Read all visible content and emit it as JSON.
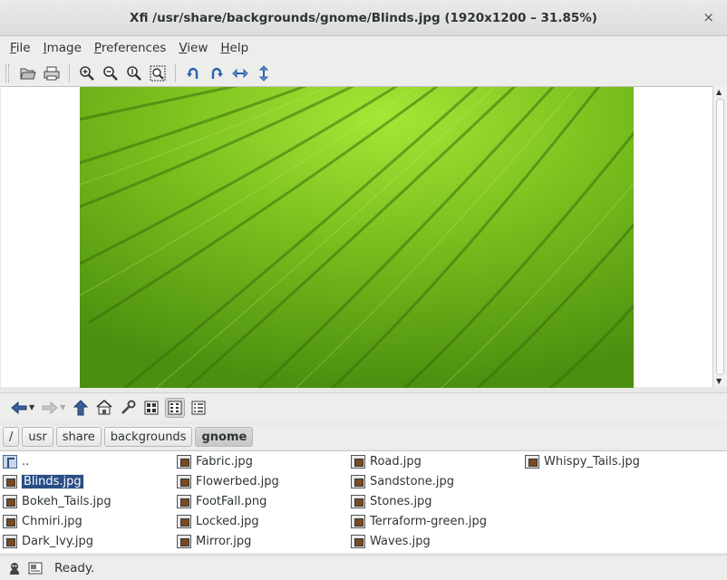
{
  "window": {
    "title": "Xfi /usr/share/backgrounds/gnome/Blinds.jpg (1920x1200 – 31.85%)",
    "close": "×"
  },
  "menu": [
    {
      "label": "File",
      "u": "F",
      "rest": "ile"
    },
    {
      "label": "Image",
      "u": "I",
      "rest": "mage"
    },
    {
      "label": "Preferences",
      "u": "P",
      "rest": "references"
    },
    {
      "label": "View",
      "u": "V",
      "rest": "iew"
    },
    {
      "label": "Help",
      "u": "H",
      "rest": "elp"
    }
  ],
  "toolbar_icons": [
    "open-folder-icon",
    "print-icon",
    "zoom-in-icon",
    "zoom-out-icon",
    "zoom-100-icon",
    "zoom-fit-icon",
    "rotate-left-icon",
    "rotate-right-icon",
    "flip-horizontal-icon",
    "flip-vertical-icon"
  ],
  "nav_icons": [
    "back-arrow-icon",
    "forward-arrow-icon",
    "up-arrow-icon",
    "home-icon",
    "wrench-icon",
    "big-icons-view-icon",
    "small-icons-view-icon",
    "details-view-icon"
  ],
  "path": {
    "crumbs": [
      "/",
      "usr",
      "share",
      "backgrounds",
      "gnome"
    ],
    "active": "gnome"
  },
  "files": {
    "col1": [
      "..",
      "Blinds.jpg",
      "Bokeh_Tails.jpg",
      "Chmiri.jpg",
      "Dark_Ivy.jpg"
    ],
    "col2": [
      "Fabric.jpg",
      "Flowerbed.jpg",
      "FootFall.png",
      "Locked.jpg",
      "Mirror.jpg"
    ],
    "col3": [
      "Road.jpg",
      "Sandstone.jpg",
      "Stones.jpg",
      "Terraform-green.jpg",
      "Waves.jpg"
    ],
    "col4": [
      "Whispy_Tails.jpg"
    ],
    "selected": "Blinds.jpg"
  },
  "status": {
    "text": "Ready."
  },
  "colors": {
    "selection": "#2a4d86",
    "leaf": "#6fb317"
  }
}
